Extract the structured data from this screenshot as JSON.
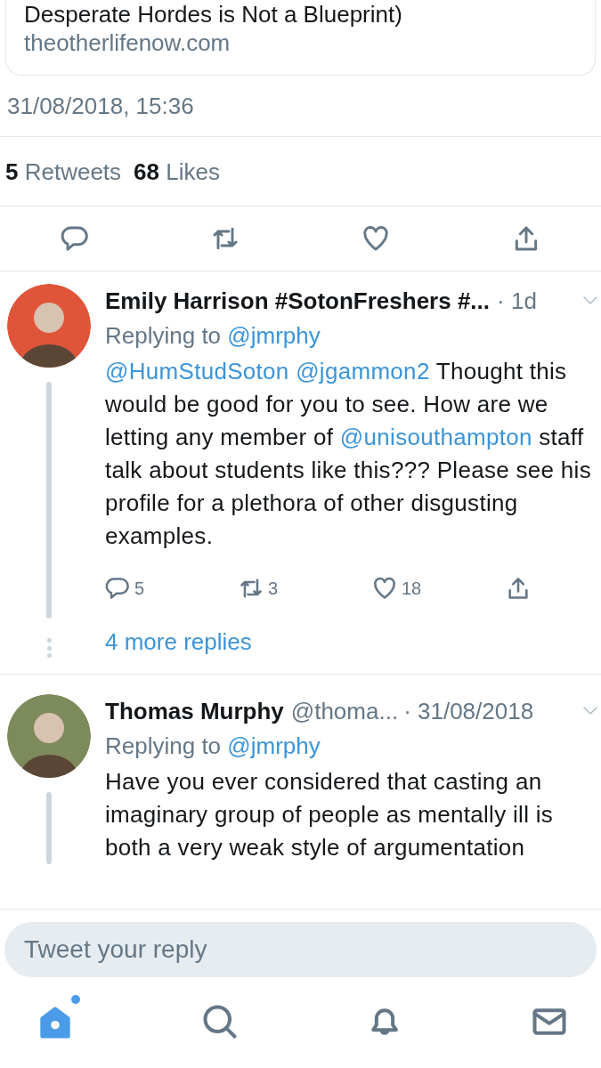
{
  "link_card": {
    "title": "Desperate Hordes is Not a Blueprint)",
    "domain": "theotherlifenow.com"
  },
  "timestamp": "31/08/2018, 15:36",
  "stats": [
    {
      "count": "5",
      "label": "Retweets"
    },
    {
      "count": "68",
      "label": "Likes"
    }
  ],
  "tweet_actions": [
    {
      "kind": "reply"
    },
    {
      "kind": "retweet"
    },
    {
      "kind": "like"
    },
    {
      "kind": "share"
    }
  ],
  "replies": [
    {
      "name": "Emily Harrison #SotonFreshers #...",
      "time": "· 1d",
      "color": "#e0553a",
      "replying_label": "Replying to",
      "replying_to": "@jmrphy",
      "body": [
        {
          "kind": "mention",
          "text": "@HumStudSoton"
        },
        {
          "kind": "mention",
          "text": "@jgammon2"
        },
        {
          "kind": "text",
          "text": " Thought this would be good for you to see. How are we letting any member of "
        },
        {
          "kind": "mention",
          "text": "@unisouthampton"
        },
        {
          "kind": "text",
          "text": " staff talk about students like this??? Please see his profile for a plethora of other disgusting examples."
        }
      ],
      "actions": [
        {
          "kind": "reply",
          "count": "5"
        },
        {
          "kind": "retweet",
          "count": "3"
        },
        {
          "kind": "like",
          "count": "18"
        },
        {
          "kind": "share"
        }
      ],
      "more_replies": "4 more replies"
    },
    {
      "name": "Thomas Murphy",
      "handle": "@thoma...",
      "time": "· 31/08/2018",
      "color": "#7d8a5c",
      "replying_label": "Replying to",
      "replying_to": "@jmrphy",
      "body": [
        {
          "kind": "text",
          "text": "Have you ever considered that casting an imaginary group of people as mentally ill is both a very weak style of argumentation"
        }
      ]
    }
  ],
  "reply_box": {
    "placeholder": "Tweet your reply"
  },
  "tabs": [
    {
      "kind": "home",
      "selected": true,
      "unread": true
    },
    {
      "kind": "search",
      "selected": false,
      "unread": false
    },
    {
      "kind": "notifications",
      "selected": false,
      "unread": false
    },
    {
      "kind": "messages",
      "selected": false,
      "unread": false
    }
  ]
}
